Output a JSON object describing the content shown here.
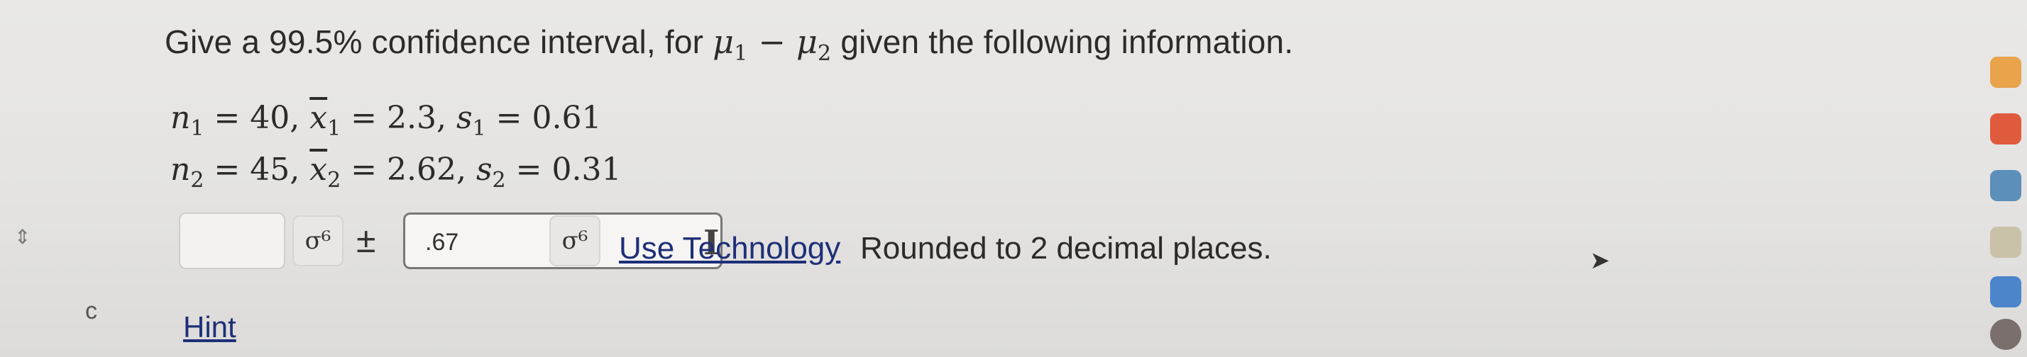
{
  "question": {
    "prefix": "Give a 99.5% confidence interval, for ",
    "mu": "μ",
    "sub1": "1",
    "minus": " − ",
    "sub2": "2",
    "suffix": " given the following information."
  },
  "givens": {
    "line1": {
      "n": "n",
      "n_sub": "1",
      "n_val": " = 40, ",
      "x": "x",
      "x_sub": "1",
      "x_val": " = 2.3, ",
      "s": "s",
      "s_sub": "1",
      "s_val": " = 0.61"
    },
    "line2": {
      "n": "n",
      "n_sub": "2",
      "n_val": " = 45, ",
      "x": "x",
      "x_sub": "2",
      "x_val": " = 2.62, ",
      "s": "s",
      "s_sub": "2",
      "s_val": " = 0.31"
    }
  },
  "answer": {
    "first_value": "",
    "plus_minus": "±",
    "second_value": ".67",
    "sigma_symbol": "σ⁶",
    "link_text": "Use Technology",
    "tail_text": " Rounded to 2 decimal places."
  },
  "hint_label": "Hint",
  "icons": {
    "sigma_button": "sigma-icon",
    "text_cursor": "text-cursor-icon",
    "mouse_pointer": "pointer-icon",
    "dock": [
      "firefox-icon",
      "app-icon",
      "app-icon",
      "app-icon",
      "app-icon",
      "app-icon"
    ]
  },
  "colors": {
    "link": "#1e2f78",
    "background": "#e6e5e3"
  }
}
